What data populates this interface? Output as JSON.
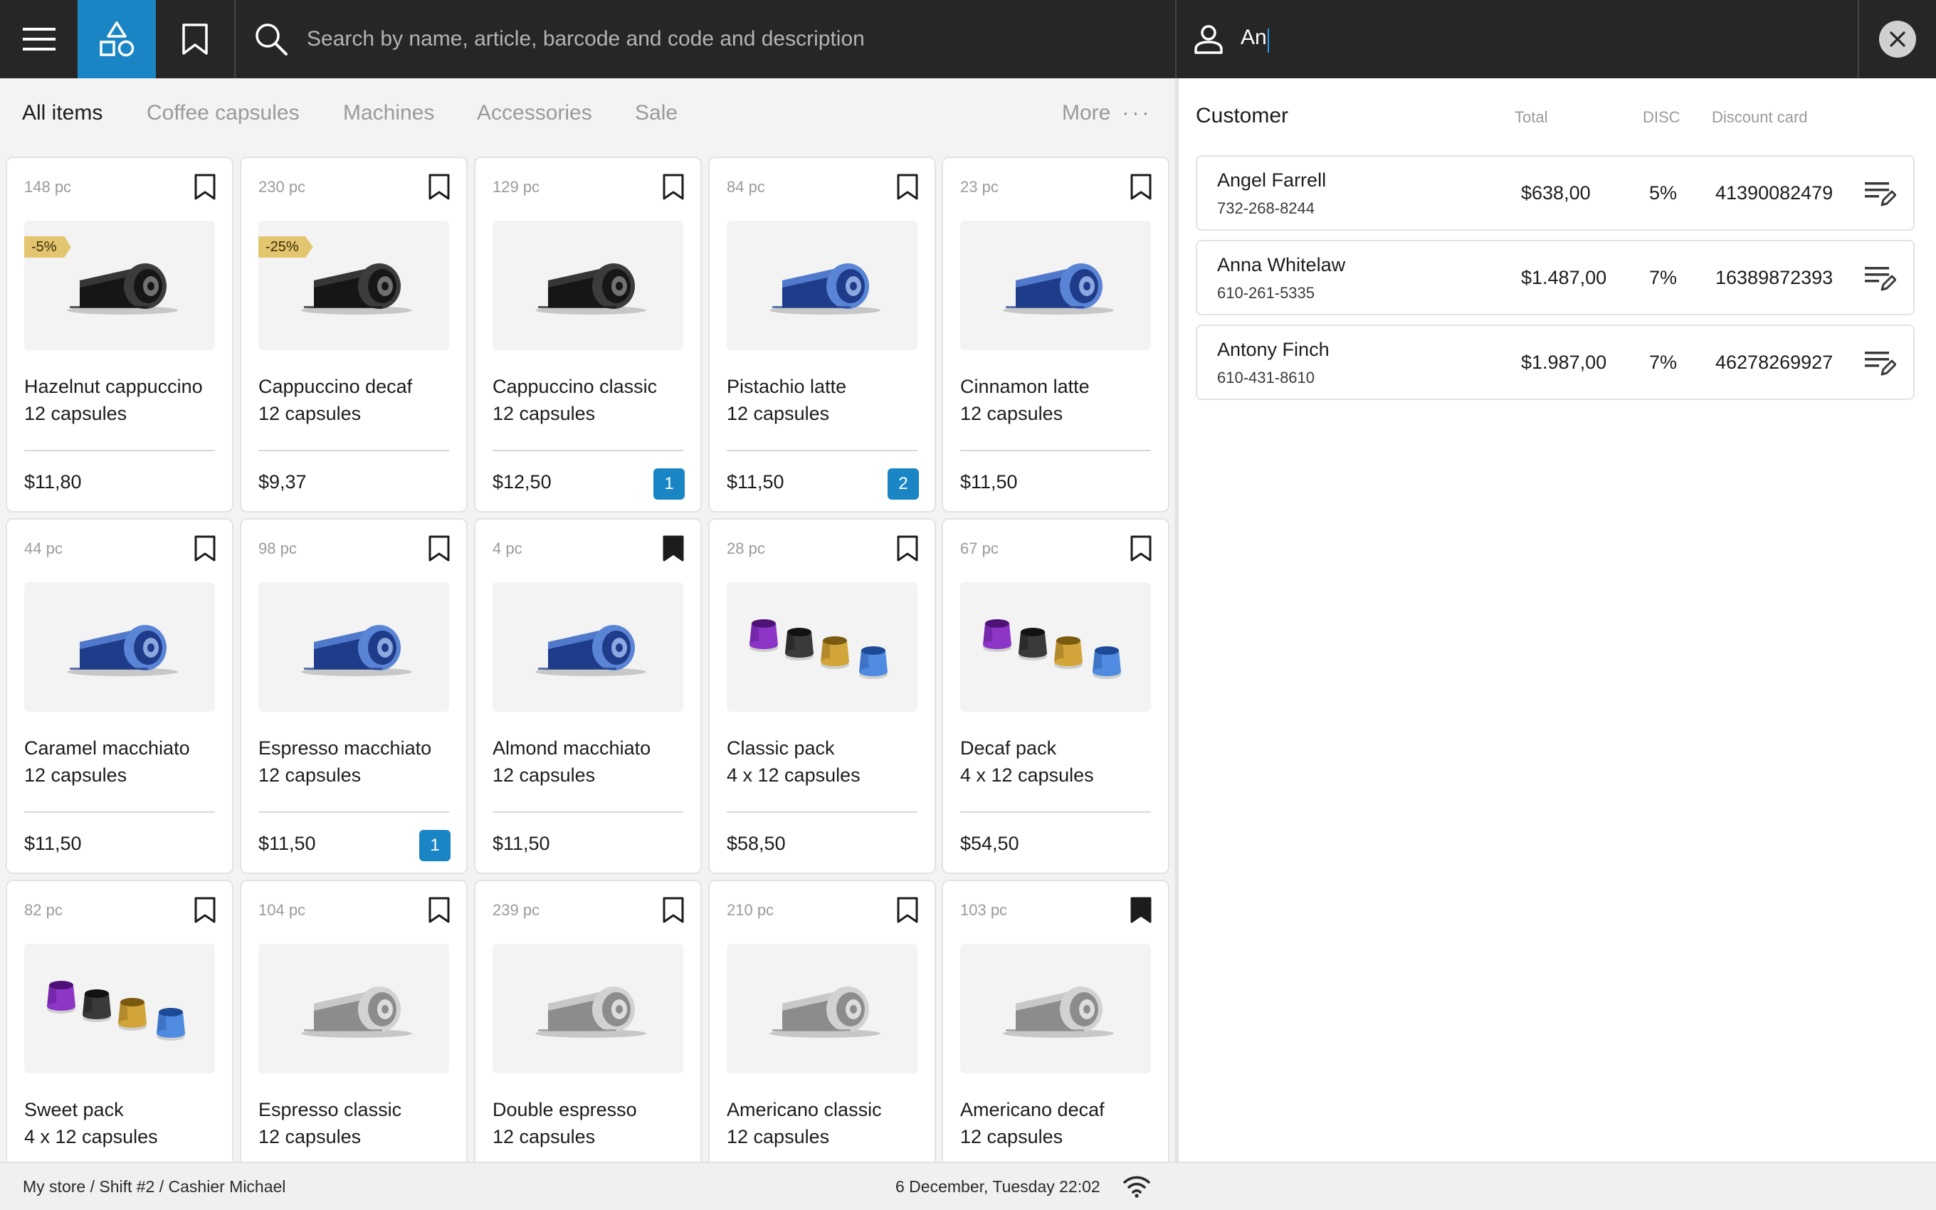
{
  "search": {
    "placeholder": "Search by name, article, barcode and code and description"
  },
  "customer_search": {
    "value": "An"
  },
  "tabs": [
    {
      "label": "All items",
      "active": true
    },
    {
      "label": "Coffee capsules",
      "active": false
    },
    {
      "label": "Machines",
      "active": false
    },
    {
      "label": "Accessories",
      "active": false
    },
    {
      "label": "Sale",
      "active": false
    }
  ],
  "more_label": "More",
  "colors": {
    "accent": "#1a85c5",
    "topbar": "#262626",
    "discount_tag": "#e2c56e"
  },
  "products": [
    {
      "stock": "148 pc",
      "name": "Hazelnut cappuccino",
      "pack": "12 capsules",
      "price": "$11,80",
      "discount": "-5%",
      "qty": "",
      "bookmarked": false,
      "image": "black-capsule"
    },
    {
      "stock": "230 pc",
      "name": "Cappuccino decaf",
      "pack": "12 capsules",
      "price": "$9,37",
      "discount": "-25%",
      "qty": "",
      "bookmarked": false,
      "image": "black-capsule"
    },
    {
      "stock": "129 pc",
      "name": "Cappuccino classic",
      "pack": "12 capsules",
      "price": "$12,50",
      "discount": "",
      "qty": "1",
      "bookmarked": false,
      "image": "black-capsule"
    },
    {
      "stock": "84 pc",
      "name": "Pistachio latte",
      "pack": "12 capsules",
      "price": "$11,50",
      "discount": "",
      "qty": "2",
      "bookmarked": false,
      "image": "blue-capsule"
    },
    {
      "stock": "23 pc",
      "name": "Cinnamon latte",
      "pack": "12 capsules",
      "price": "$11,50",
      "discount": "",
      "qty": "",
      "bookmarked": false,
      "image": "blue-capsule"
    },
    {
      "stock": "44 pc",
      "name": "Caramel macchiato",
      "pack": "12 capsules",
      "price": "$11,50",
      "discount": "",
      "qty": "",
      "bookmarked": false,
      "image": "blue-capsule"
    },
    {
      "stock": "98 pc",
      "name": "Espresso macchiato",
      "pack": "12 capsules",
      "price": "$11,50",
      "discount": "",
      "qty": "1",
      "bookmarked": false,
      "image": "blue-capsule"
    },
    {
      "stock": "4 pc",
      "name": "Almond macchiato",
      "pack": "12 capsules",
      "price": "$11,50",
      "discount": "",
      "qty": "",
      "bookmarked": true,
      "image": "blue-capsule"
    },
    {
      "stock": "28 pc",
      "name": "Classic pack",
      "pack": "4 x 12 capsules",
      "price": "$58,50",
      "discount": "",
      "qty": "",
      "bookmarked": false,
      "image": "capsule-set"
    },
    {
      "stock": "67 pc",
      "name": "Decaf pack",
      "pack": "4 x 12 capsules",
      "price": "$54,50",
      "discount": "",
      "qty": "",
      "bookmarked": false,
      "image": "capsule-set"
    },
    {
      "stock": "82 pc",
      "name": "Sweet pack",
      "pack": "4 x 12 capsules",
      "price": "",
      "discount": "",
      "qty": "",
      "bookmarked": false,
      "image": "capsule-set"
    },
    {
      "stock": "104 pc",
      "name": "Espresso classic",
      "pack": "12 capsules",
      "price": "",
      "discount": "",
      "qty": "",
      "bookmarked": false,
      "image": "silver-capsule"
    },
    {
      "stock": "239 pc",
      "name": "Double espresso",
      "pack": "12 capsules",
      "price": "",
      "discount": "",
      "qty": "",
      "bookmarked": false,
      "image": "silver-capsule"
    },
    {
      "stock": "210 pc",
      "name": "Americano classic",
      "pack": "12 capsules",
      "price": "",
      "discount": "",
      "qty": "",
      "bookmarked": false,
      "image": "silver-capsule"
    },
    {
      "stock": "103 pc",
      "name": "Americano decaf",
      "pack": "12 capsules",
      "price": "",
      "discount": "",
      "qty": "",
      "bookmarked": true,
      "image": "silver-capsule"
    }
  ],
  "customer_panel": {
    "title": "Customer",
    "headers": {
      "total": "Total",
      "disc": "DISC",
      "card": "Discount card"
    },
    "rows": [
      {
        "name": "Angel Farrell",
        "phone": "732-268-8244",
        "total": "$638,00",
        "disc": "5%",
        "card": "41390082479"
      },
      {
        "name": "Anna Whitelaw",
        "phone": "610-261-5335",
        "total": "$1.487,00",
        "disc": "7%",
        "card": "16389872393"
      },
      {
        "name": "Antony Finch",
        "phone": "610-431-8610",
        "total": "$1.987,00",
        "disc": "7%",
        "card": "46278269927"
      }
    ]
  },
  "status": {
    "location": "My store / Shift #2 / Cashier Michael",
    "datetime": "6 December, Tuesday 22:02"
  }
}
